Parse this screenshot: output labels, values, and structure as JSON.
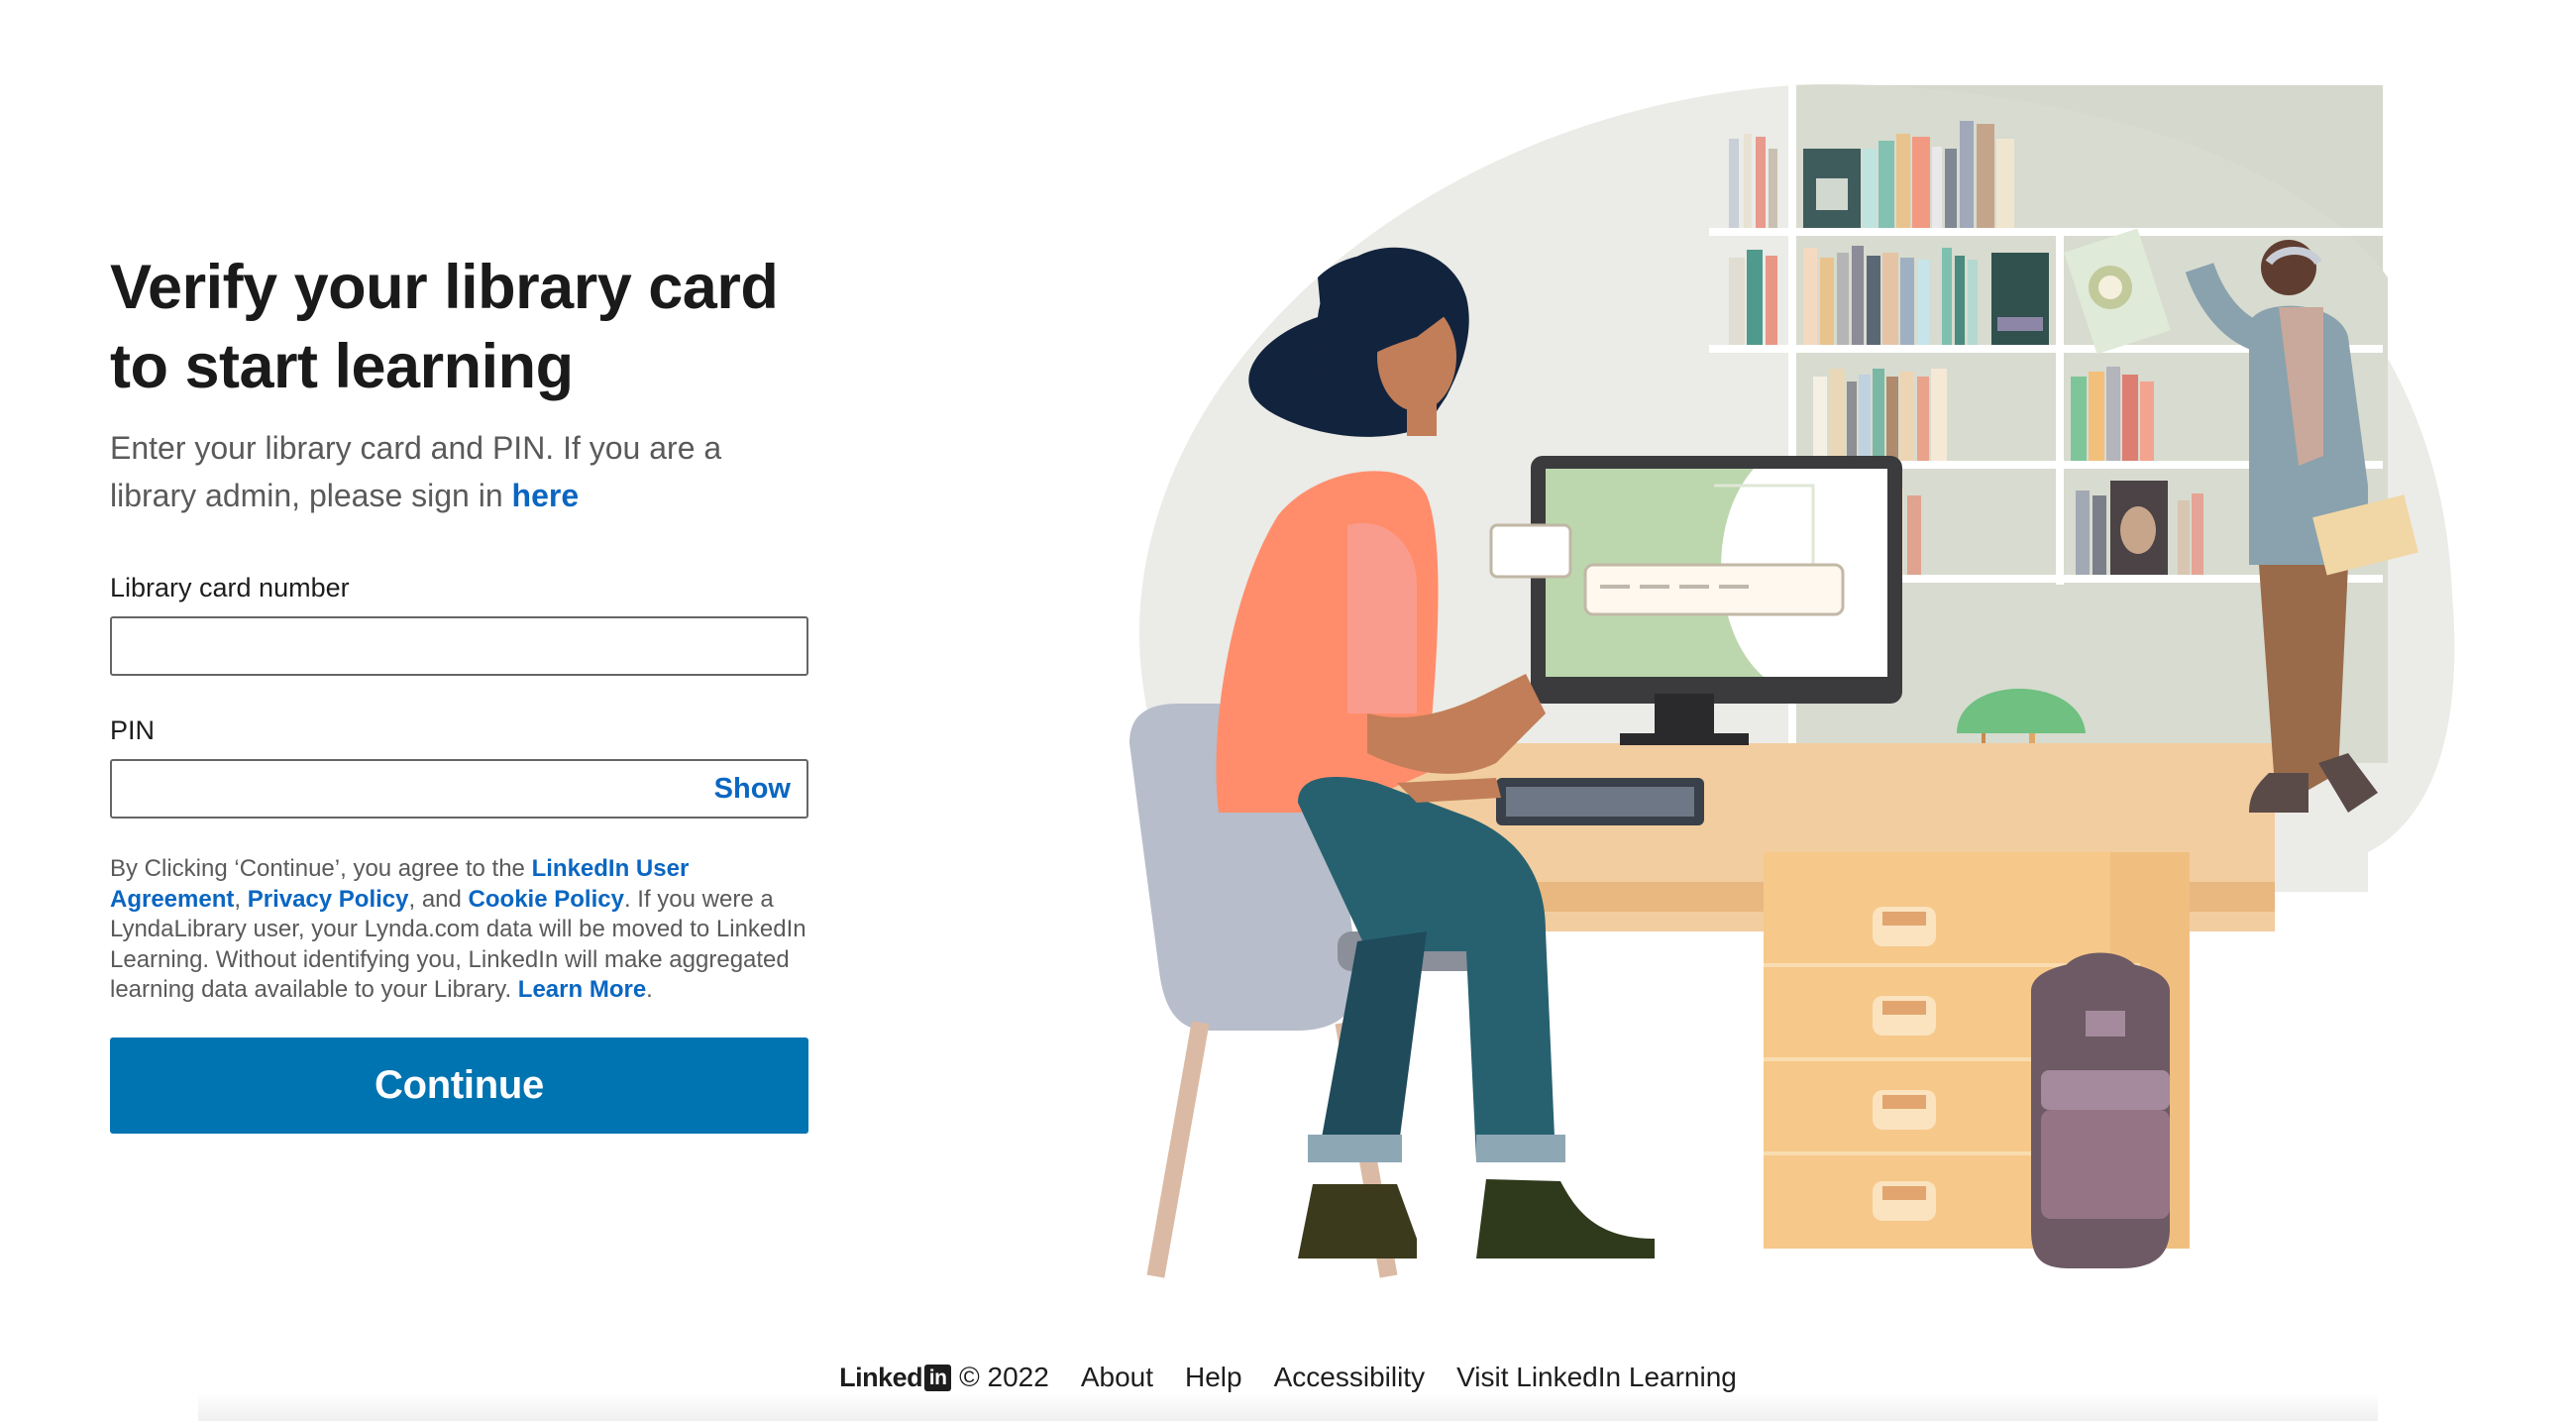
{
  "heading": {
    "line1": "Verify your library card",
    "line2": "to start learning"
  },
  "subtitle": {
    "text": "Enter your library card and PIN. If you are a library admin, please sign in ",
    "link": "here"
  },
  "card_field": {
    "label": "Library card number",
    "value": ""
  },
  "pin_field": {
    "label": "PIN",
    "value": "",
    "toggle_label": "Show"
  },
  "legal": {
    "part1": "By Clicking ‘Continue’, you agree to the ",
    "user_agreement": "LinkedIn User Agreement",
    "sep1": ", ",
    "privacy": "Privacy Policy",
    "sep2": ", and ",
    "cookie": "Cookie Policy",
    "part2": ". If you were a LyndaLibrary user, your Lynda.com data will be moved to LinkedIn Learning. Without identifying you, LinkedIn will make aggregated learning data available to your Library. ",
    "learn_more": "Learn More",
    "end": "."
  },
  "continue_button": "Continue",
  "footer": {
    "logo_text": "Linked",
    "logo_in": "in",
    "copyright": "© 2022",
    "links": [
      "About",
      "Help",
      "Accessibility",
      "Visit LinkedIn Learning"
    ]
  },
  "colors": {
    "brand_blue": "#0073b1",
    "link_blue": "#0a66c2"
  }
}
